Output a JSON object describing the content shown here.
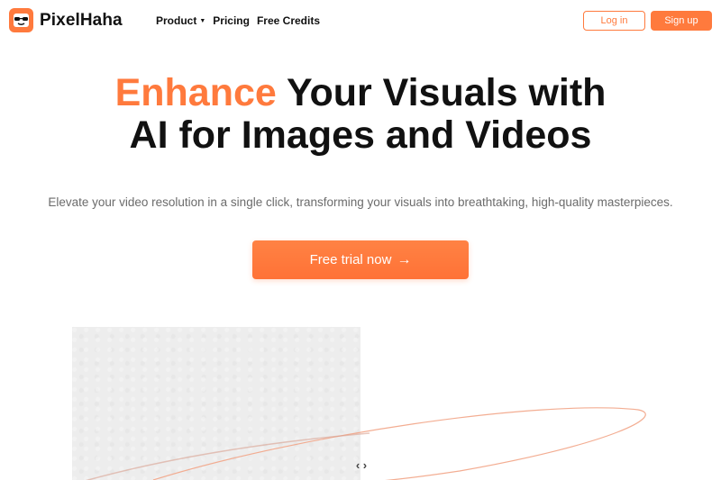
{
  "brand": {
    "name": "PixelHaha",
    "accent_color": "#ff7a3d",
    "logo_icon": "sunglasses-face-icon"
  },
  "nav": {
    "items": [
      {
        "label": "Product",
        "has_dropdown": true
      },
      {
        "label": "Pricing",
        "has_dropdown": false
      },
      {
        "label": "Free Credits",
        "has_dropdown": false
      }
    ]
  },
  "auth": {
    "login_label": "Log in",
    "signup_label": "Sign up"
  },
  "hero": {
    "title_accent": "Enhance",
    "title_rest_line1": " Your Visuals with",
    "title_line2": "AI for Images and Videos",
    "subtitle": "Elevate your video resolution in a single click, transforming your visuals into breathtaking, high-quality masterpieces.",
    "cta_label": "Free trial now"
  },
  "comparison": {
    "handle_icon": "chevrons-left-right-icon"
  }
}
